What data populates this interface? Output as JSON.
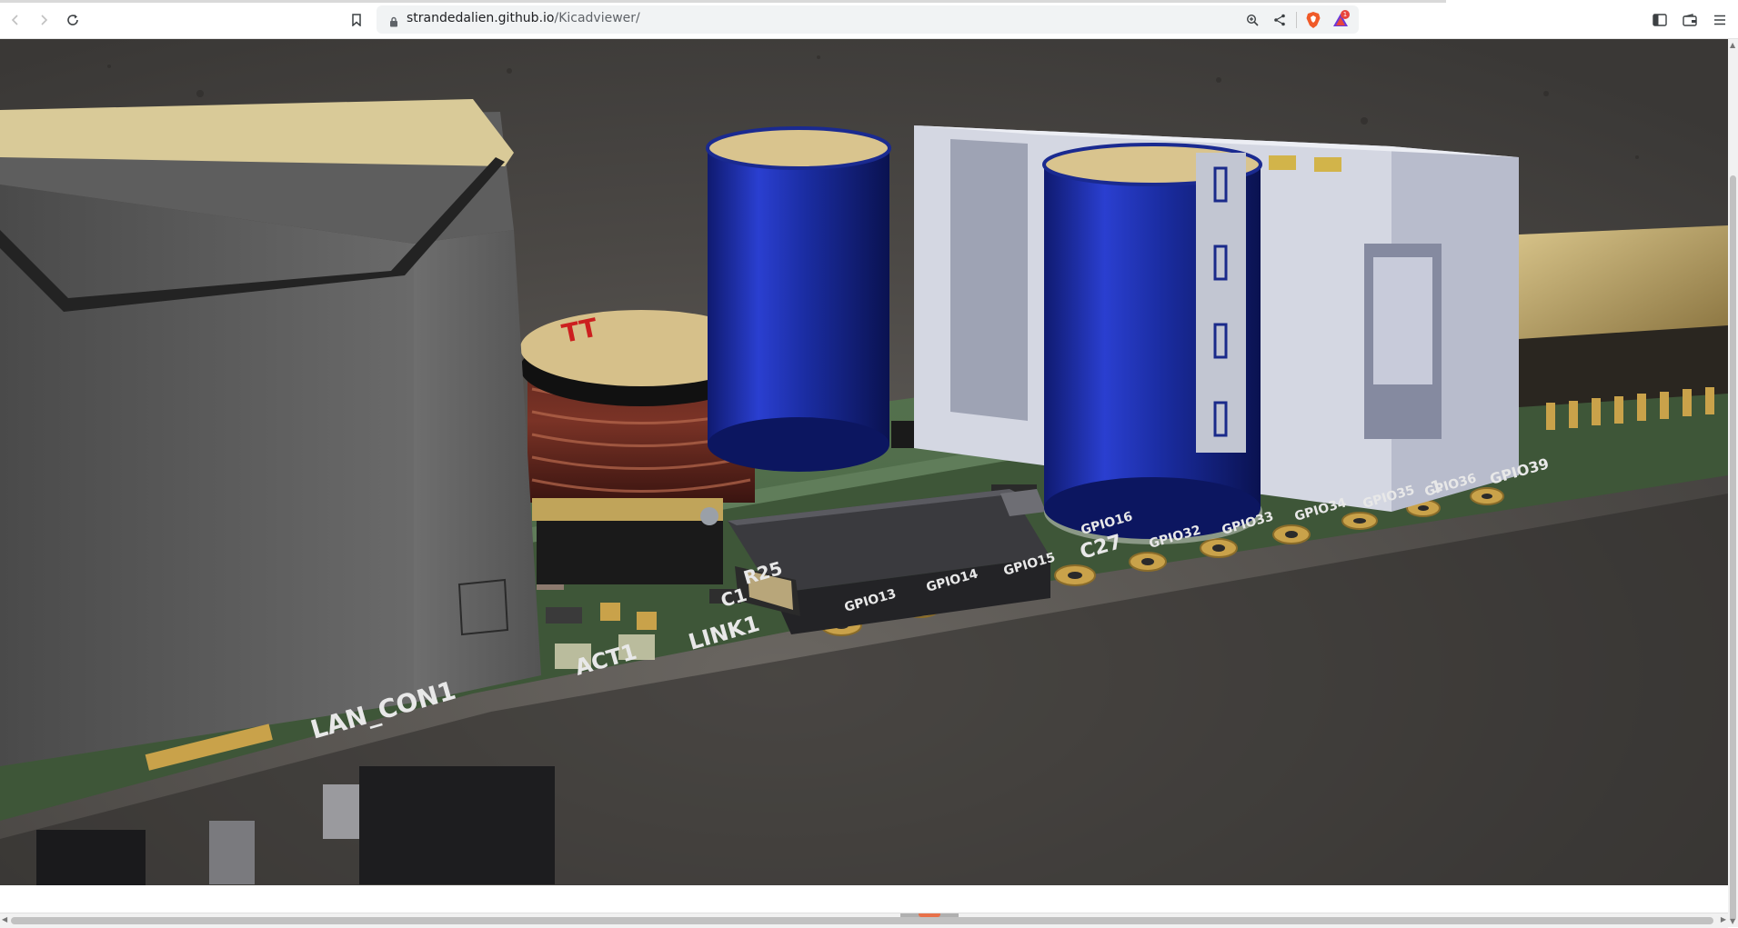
{
  "browser": {
    "url_host": "strandedalien.github.io",
    "url_path": "/Kicadviewer/",
    "notification_count": "1",
    "icons": [
      "back-icon",
      "forward-icon",
      "reload-icon",
      "bookmark-icon",
      "lock-icon",
      "zoom-icon",
      "share-icon",
      "brave-shield-icon",
      "brave-rewards-icon",
      "sidebar-icon",
      "wallet-icon",
      "menu-icon"
    ]
  },
  "scene": {
    "silkscreen": {
      "lan": "LAN_CON1",
      "act": "ACT1",
      "link": "LINK1",
      "c1": "C1",
      "r25": "R25",
      "c27": "C27",
      "gpio13": "GPIO13",
      "gpio14": "GPIO14",
      "gpio15": "GPIO15",
      "gpio16": "GPIO16",
      "gpio32": "GPIO32",
      "gpio33": "GPIO33",
      "gpio34": "GPIO34",
      "gpio35": "GPIO35",
      "gpio36": "GPIO36",
      "gpio39": "GPIO39",
      "pin1": "1",
      "inductor_mark": "TT"
    },
    "colors": {
      "pcb_green": "#4e6b4a",
      "capacitor_blue": "#1c2fa8",
      "pad_gold": "#c9a24a",
      "connector_white": "#d8dae6"
    }
  }
}
